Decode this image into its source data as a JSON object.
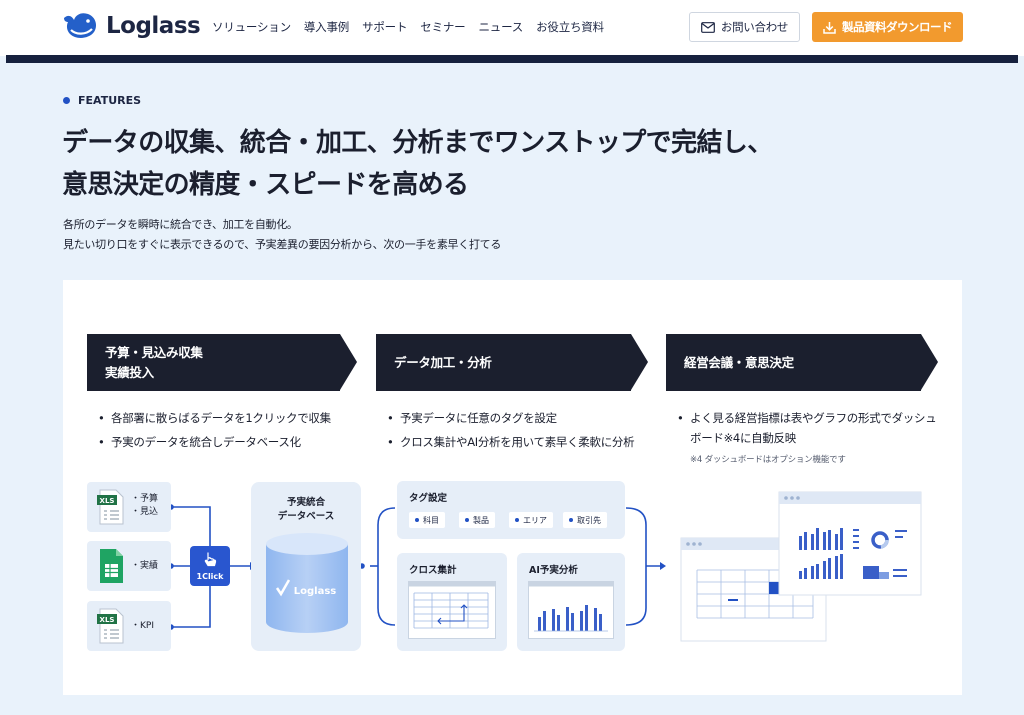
{
  "brand": {
    "name": "Loglass"
  },
  "nav": {
    "items": [
      "ソリューション",
      "導入事例",
      "サポート",
      "セミナー",
      "ニュース",
      "お役立ち資料"
    ],
    "contact_label": "お問い合わせ",
    "download_label": "製品資料ダウンロード"
  },
  "intro": {
    "kicker": "FEATURES",
    "headline_line1": "データの収集、統合・加工、分析までワンストップで完結し、",
    "headline_line2": "意思決定の精度・スピードを高める",
    "sub_line1": "各所のデータを瞬時に統合でき、加工を自動化。",
    "sub_line2": "見たい切り口をすぐに表示できるので、予実差異の要因分析から、次の一手を素早く打てる"
  },
  "steps": [
    {
      "title_line1": "予算・見込み収集",
      "title_line2": "実績投入",
      "bullets": [
        "各部署に散らばるデータを1クリックで収集",
        "予実のデータを統合しデータベース化"
      ]
    },
    {
      "title_line1": "データ加工・分析",
      "title_line2": "",
      "bullets": [
        "予実データに任意のタグを設定",
        "クロス集計やAI分析を用いて素早く柔軟に分析"
      ]
    },
    {
      "title_line1": "経営会議・意思決定",
      "title_line2": "",
      "bullets": [
        "よく見る経営指標は表やグラフの形式でダッシュボード※4に自動反映"
      ],
      "note": "※4 ダッシュボードはオプション機能です"
    }
  ],
  "diagram": {
    "sources": [
      {
        "icon": "xls-file-icon",
        "label_line1": "・予算",
        "label_line2": "・見込"
      },
      {
        "icon": "sheets-file-icon",
        "label_line1": "・実績",
        "label_line2": ""
      },
      {
        "icon": "xls-file-icon",
        "label_line1": "・KPI",
        "label_line2": ""
      }
    ],
    "xls_badge": "XLS",
    "one_click_label": "1Click",
    "db_caption_line1": "予実統合",
    "db_caption_line2": "データベース",
    "db_brand": "Loglass",
    "tag_settings_title": "タグ設定",
    "tags": [
      "科目",
      "製品",
      "エリア",
      "取引先"
    ],
    "cross_title": "クロス集計",
    "ai_title": "AI予実分析"
  },
  "colors": {
    "navy": "#1b1f2e",
    "accent_blue": "#2251c4",
    "orange": "#f29a2e",
    "page_bg": "#e9f2fb",
    "tile_bg": "#e6eef8"
  }
}
